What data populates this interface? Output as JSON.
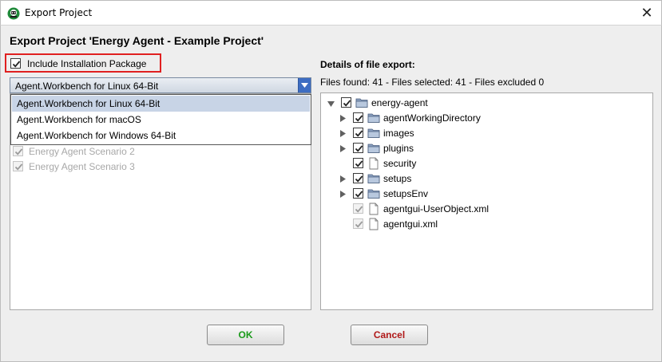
{
  "window": {
    "title": "Export Project",
    "close_symbol": "✕"
  },
  "heading": "Export Project 'Energy Agent - Example Project'",
  "include": {
    "label": "Include Installation Package",
    "checked": true
  },
  "combo": {
    "selected": "Agent.Workbench for Linux 64-Bit",
    "options": [
      "Agent.Workbench for Linux 64-Bit",
      "Agent.Workbench for macOS",
      "Agent.Workbench for Windows 64-Bit"
    ]
  },
  "scenarios": [
    {
      "label": "Energy Agent Scenario 2",
      "checked": true
    },
    {
      "label": "Energy Agent Scenario 3",
      "checked": true
    }
  ],
  "details": {
    "label": "Details of file export:",
    "files_found": "Files found: 41 - Files selected: 41 - Files excluded 0"
  },
  "tree": {
    "root": {
      "label": "energy-agent",
      "type": "folder",
      "expanded": true,
      "checked": true
    },
    "children": [
      {
        "label": "agentWorkingDirectory",
        "type": "folder",
        "expandable": true,
        "checked": true
      },
      {
        "label": "images",
        "type": "folder",
        "expandable": true,
        "checked": true
      },
      {
        "label": "plugins",
        "type": "folder",
        "expandable": true,
        "checked": true
      },
      {
        "label": "security",
        "type": "file",
        "expandable": false,
        "checked": true
      },
      {
        "label": "setups",
        "type": "folder",
        "expandable": true,
        "checked": true
      },
      {
        "label": "setupsEnv",
        "type": "folder",
        "expandable": true,
        "checked": true
      },
      {
        "label": "agentgui-UserObject.xml",
        "type": "file",
        "expandable": false,
        "checked": true,
        "disabled": true
      },
      {
        "label": "agentgui.xml",
        "type": "file",
        "expandable": false,
        "checked": true,
        "disabled": true
      }
    ]
  },
  "buttons": {
    "ok": "OK",
    "cancel": "Cancel"
  },
  "colors": {
    "ok_text": "#1a9a1a",
    "cancel_text": "#b01818",
    "highlight_border": "#e02020",
    "combo_arrow_bg": "#3d6dc2"
  }
}
